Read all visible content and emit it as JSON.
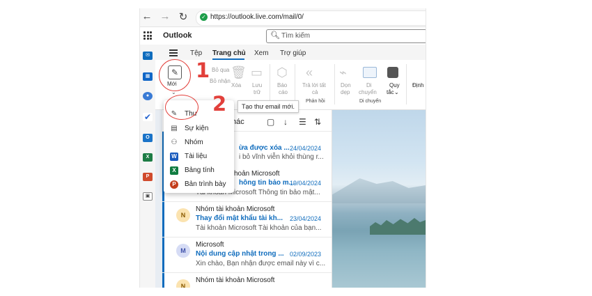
{
  "browser": {
    "back": "←",
    "forward": "→",
    "reload": "↻",
    "url": "https://outlook.live.com/mail/0/"
  },
  "app": {
    "name": "Outlook",
    "search_placeholder": "Tìm kiếm"
  },
  "tabs": [
    "Tệp",
    "Trang chủ",
    "Xem",
    "Trợ giúp"
  ],
  "ribbon": {
    "new_label": "Mới",
    "forward_label": "Bỏ qua",
    "forward_label2": "Bỏ nhận",
    "delete_label": "Xóa",
    "archive_label": "Lưu",
    "archive_label2": "trữ",
    "report_label": "Báo",
    "report_label2": "cáo",
    "reply_all_label": "Trả lời tất",
    "reply_all_label2": "cả",
    "respond_group": "Phản hồi",
    "sweep_label": "Dọn",
    "sweep_label2": "dẹp",
    "move_label": "Di",
    "move_label2": "chuyển",
    "rules_label": "Quy",
    "rules_label2": "tắc",
    "move_group": "Di chuyển",
    "categorize_label": "Định"
  },
  "list_header": {
    "other_tab": "hác"
  },
  "new_menu": {
    "items": [
      {
        "label": "Thư",
        "icon": "compose-icon"
      },
      {
        "label": "Sự kiện",
        "icon": "calendar-icon"
      },
      {
        "label": "Nhóm",
        "icon": "group-icon"
      },
      {
        "label": "Tài liệu",
        "icon": "word-icon"
      },
      {
        "label": "Bảng tính",
        "icon": "excel-icon"
      },
      {
        "label": "Bản trình bày",
        "icon": "powerpoint-icon"
      }
    ],
    "tooltip": "Tạo thư email mới."
  },
  "messages": [
    {
      "sender": "",
      "subject": "ừa được xóa ...",
      "date": "24/04/2024",
      "preview": "i bỏ vĩnh viễn khỏi thùng r...",
      "avatar": ""
    },
    {
      "sender": "hoản Microsoft",
      "subject": "hông tin bảo m...",
      "date": "19/04/2024",
      "preview": "Tài khoản Microsoft Thông tin bảo mật...",
      "avatar": ""
    },
    {
      "sender": "Nhóm tài khoản Microsoft",
      "subject": "Thay đổi mật khẩu tài kh...",
      "date": "23/04/2024",
      "preview": "Tài khoản Microsoft Tài khoản của bạn...",
      "avatar": "N"
    },
    {
      "sender": "Microsoft",
      "subject": "Nội dung cập nhật trong ...",
      "date": "02/09/2023",
      "preview": "Xin chào, Bạn nhận được email này vì c...",
      "avatar": "M"
    },
    {
      "sender": "Nhóm tài khoản Microsoft",
      "subject": "",
      "date": "",
      "preview": "",
      "avatar": "N"
    }
  ],
  "annotations": {
    "step1": "1",
    "step2": "2"
  },
  "colors": {
    "accent": "#0f6cbd",
    "annotation": "#e2403b"
  }
}
